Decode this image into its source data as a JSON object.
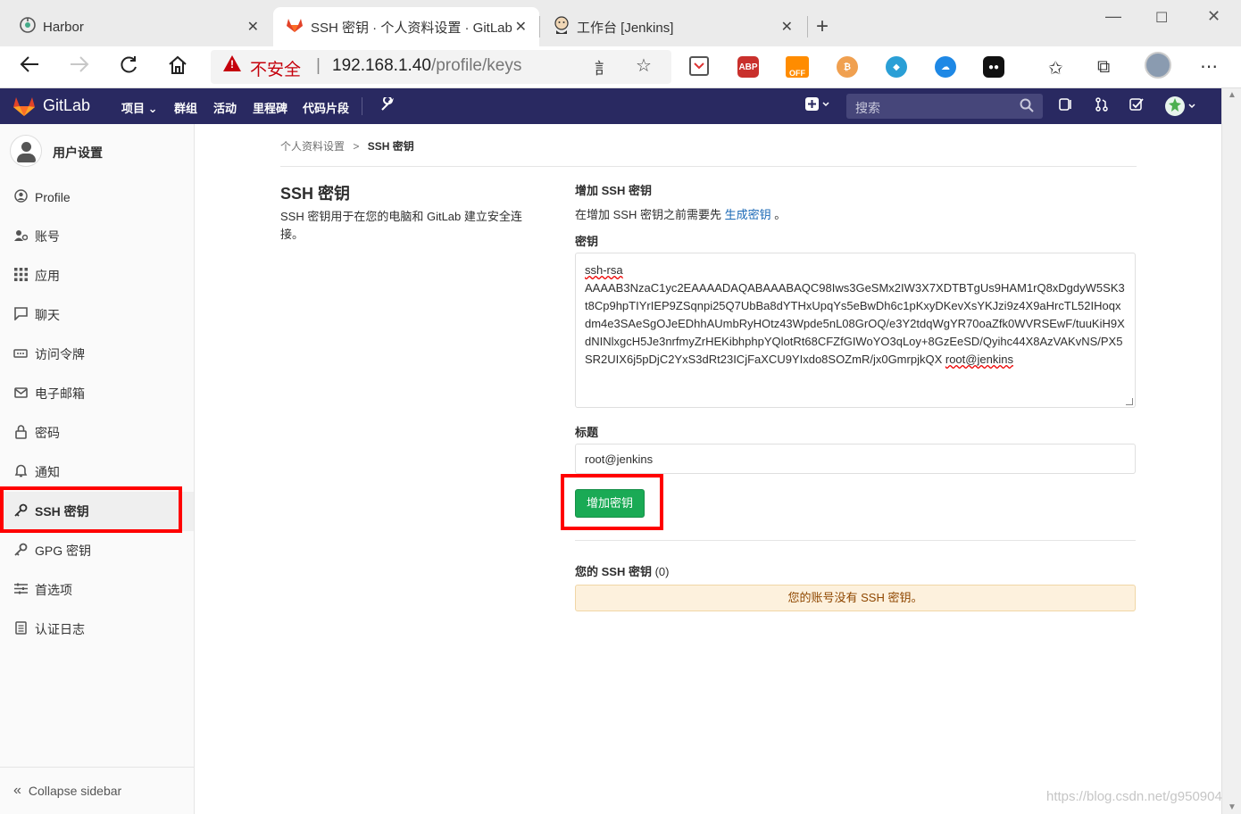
{
  "browser": {
    "tabs": [
      {
        "title": "Harbor",
        "icon": "harbor-icon"
      },
      {
        "title": "SSH 密钥 · 个人资料设置 · GitLab",
        "icon": "gitlab-icon",
        "active": true
      },
      {
        "title": "工作台 [Jenkins]",
        "icon": "jenkins-icon"
      }
    ],
    "address": {
      "warning": "不安全",
      "separator": "|",
      "host": "192.168.1.40",
      "path": "/profile/keys"
    },
    "extensions": [
      "ABP",
      "OFF"
    ]
  },
  "gitlab": {
    "brand": "GitLab",
    "nav": [
      "项目",
      "群组",
      "活动",
      "里程碑",
      "代码片段"
    ],
    "search_placeholder": "搜索"
  },
  "sidebar": {
    "title": "用户设置",
    "items": [
      {
        "label": "Profile",
        "icon": "profile-icon"
      },
      {
        "label": "账号",
        "icon": "account-icon"
      },
      {
        "label": "应用",
        "icon": "apps-icon"
      },
      {
        "label": "聊天",
        "icon": "chat-icon"
      },
      {
        "label": "访问令牌",
        "icon": "token-icon"
      },
      {
        "label": "电子邮箱",
        "icon": "email-icon"
      },
      {
        "label": "密码",
        "icon": "lock-icon"
      },
      {
        "label": "通知",
        "icon": "bell-icon"
      },
      {
        "label": "SSH 密钥",
        "icon": "key-icon",
        "active": true
      },
      {
        "label": "GPG 密钥",
        "icon": "key-icon"
      },
      {
        "label": "首选项",
        "icon": "preferences-icon"
      },
      {
        "label": "认证日志",
        "icon": "log-icon"
      }
    ],
    "collapse": "Collapse sidebar"
  },
  "breadcrumb": {
    "parent": "个人资料设置",
    "separator": ">",
    "current": "SSH 密钥"
  },
  "main": {
    "left_title": "SSH 密钥",
    "left_desc": "SSH 密钥用于在您的电脑和 GitLab 建立安全连接。",
    "add_title": "增加 SSH 密钥",
    "add_hint_before": "在增加 SSH 密钥之前需要先 ",
    "add_hint_link": "生成密钥",
    "add_hint_after": " 。",
    "key_label": "密钥",
    "key_value_prefix": "ssh-rsa",
    "key_value_body": "AAAAB3NzaC1yc2EAAAADAQABAAABAQC98Iws3GeSMx2IW3X7XDTBTgUs9HAM1rQ8xDgdyW5SK3t8Cp9hpTIYrIEP9ZSqnpi25Q7UbBa8dYTHxUpqYs5eBwDh6c1pKxyDKevXsYKJzi9z4X9aHrcTL52IHoqxdm4e3SAeSgOJeEDhhAUmbRyHOtz43Wpde5nL08GrOQ/e3Y2tdqWgYR70oaZfk0WVRSEwF/tuuKiH9XdNINlxgcH5Je3nrfmyZrHEKibhphpYQlotRt68CFZfGIWoYO3qLoy+8GzEeSD/Qyihc44X8AzVAKvNS/PX5SR2UIX6j5pDjC2YxS3dRt23ICjFaXCU9YIxdo8SOZmR/jx0GmrpjkQX",
    "key_value_suffix": "root@jenkins",
    "title_label": "标题",
    "title_value": "root@jenkins",
    "add_button": "增加密钥",
    "your_keys_label": "您的 SSH 密钥",
    "your_keys_count": "(0)",
    "empty_notice": "您的账号没有 SSH 密钥。"
  },
  "watermark": "https://blog.csdn.net/g950904",
  "colors": {
    "header_bg": "#292961",
    "button_green": "#1aaa55",
    "highlight_red": "#ff0000",
    "link_blue": "#1b69b6",
    "notice_bg": "#fdf1dd"
  }
}
